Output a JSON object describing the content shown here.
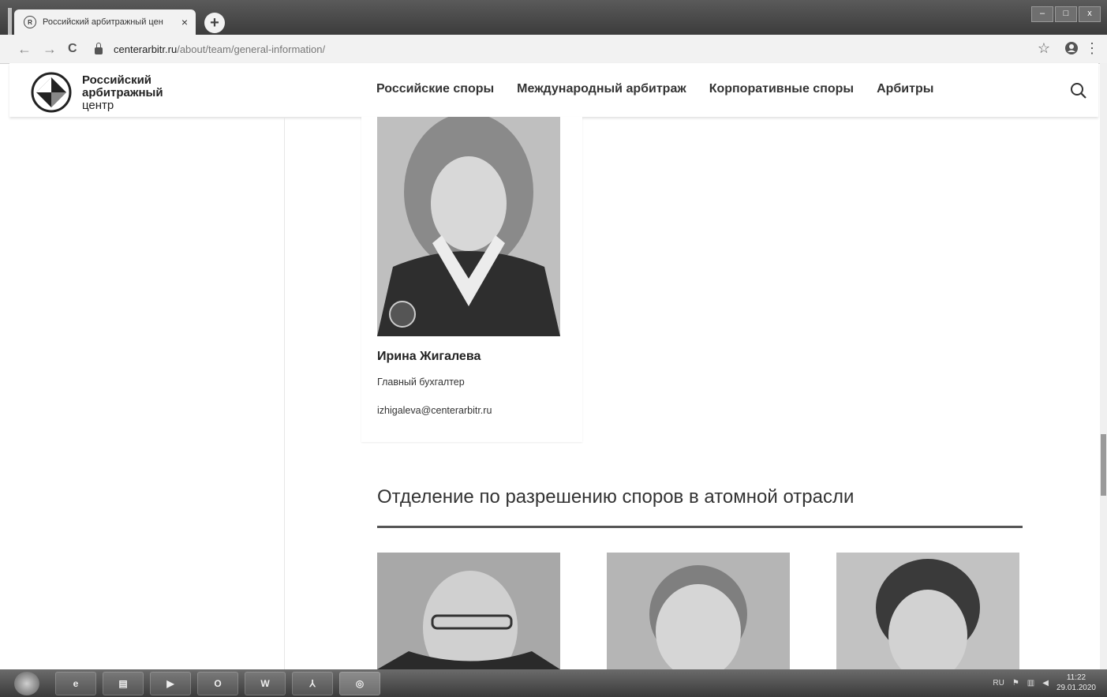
{
  "browser": {
    "tab_title": "Российский арбитражный цен",
    "tab_close": "×",
    "new_tab": "+",
    "url_host": "centerarbitr.ru",
    "url_path": "/about/team/general-information/",
    "back": "←",
    "forward": "→",
    "reload": "C",
    "star": "☆",
    "menu": "⋮",
    "min": "–",
    "max": "□",
    "close": "x"
  },
  "site": {
    "brand_line1": "Российский",
    "brand_line2": "арбитражный",
    "brand_line3": "центр",
    "nav": [
      "Российские споры",
      "Международный арбитраж",
      "Корпоративные споры",
      "Арбитры"
    ]
  },
  "person": {
    "name": "Ирина Жигалева",
    "role": "Главный бухгалтер",
    "email": "izhigaleva@centerarbitr.ru"
  },
  "section": {
    "title": "Отделение по разрешению споров в атомной отрасли"
  },
  "taskbar": {
    "lang": "RU",
    "time": "11:22",
    "date": "29.01.2020"
  }
}
